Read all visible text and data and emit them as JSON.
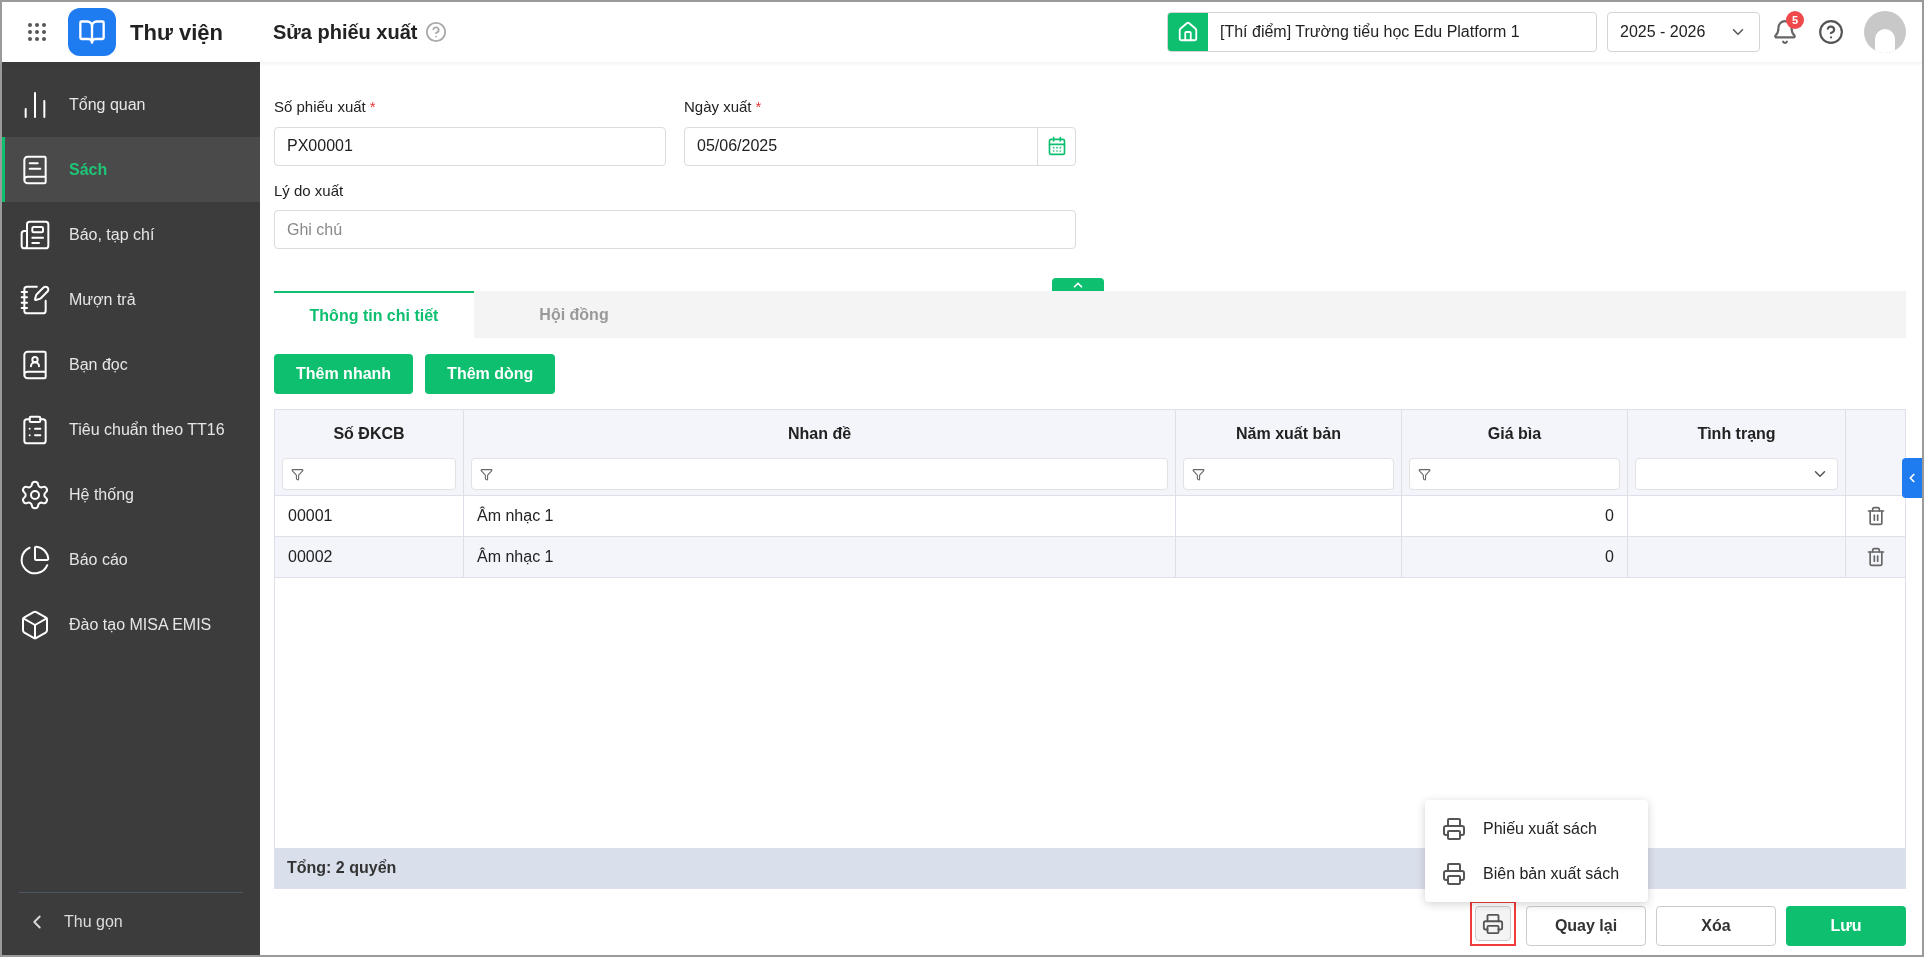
{
  "header": {
    "app_title": "Thư viện",
    "page_title": "Sửa phiếu xuất",
    "school": "[Thí điểm] Trường tiểu học Edu Platform 1",
    "school_year": "2025 - 2026",
    "notification_count": "5"
  },
  "sidebar": {
    "items": [
      {
        "label": "Tổng quan",
        "selected": false
      },
      {
        "label": "Sách",
        "selected": true
      },
      {
        "label": "Báo, tạp chí",
        "selected": false
      },
      {
        "label": "Mượn trả",
        "selected": false
      },
      {
        "label": "Bạn đọc",
        "selected": false
      },
      {
        "label": "Tiêu chuẩn theo TT16",
        "selected": false
      },
      {
        "label": "Hệ thống",
        "selected": false
      },
      {
        "label": "Báo cáo",
        "selected": false
      },
      {
        "label": "Đào tạo MISA EMIS",
        "selected": false
      }
    ],
    "collapse": "Thu gọn"
  },
  "form": {
    "required_mark": "*",
    "fields": [
      {
        "label": "Số phiếu xuất",
        "required": true,
        "value": "PX00001",
        "kind": "text"
      },
      {
        "label": "Ngày xuất",
        "required": true,
        "value": "05/06/2025",
        "kind": "date"
      }
    ],
    "reason": {
      "label": "Lý do xuất",
      "placeholder": "Ghi chú"
    }
  },
  "tabs": [
    {
      "label": "Thông tin chi tiết",
      "selected": true
    },
    {
      "label": "Hội đồng",
      "selected": false
    }
  ],
  "actions": [
    "Thêm nhanh",
    "Thêm dòng"
  ],
  "table": {
    "columns": [
      {
        "label": "Số ĐKCB",
        "kind": "text"
      },
      {
        "label": "Nhan đề",
        "kind": "text"
      },
      {
        "label": "Năm xuất bản",
        "kind": "text"
      },
      {
        "label": "Giá bìa",
        "kind": "number"
      },
      {
        "label": "Tình trạng",
        "kind": "select"
      }
    ],
    "rows": [
      {
        "cells": [
          "00001",
          "Âm nhạc 1",
          "",
          "0",
          ""
        ]
      },
      {
        "cells": [
          "00002",
          "Âm nhạc 1",
          "",
          "0",
          ""
        ]
      }
    ],
    "footer": "Tổng: 2 quyển"
  },
  "print_menu": {
    "items": [
      "Phiếu xuất sách",
      "Biên bản xuất sách"
    ]
  },
  "print_button": {
    "highlighted": true
  },
  "buttons": [
    {
      "label": "Quay lại",
      "kind": "outline"
    },
    {
      "label": "Xóa",
      "kind": "outline"
    },
    {
      "label": "Lưu",
      "kind": "primary"
    }
  ]
}
